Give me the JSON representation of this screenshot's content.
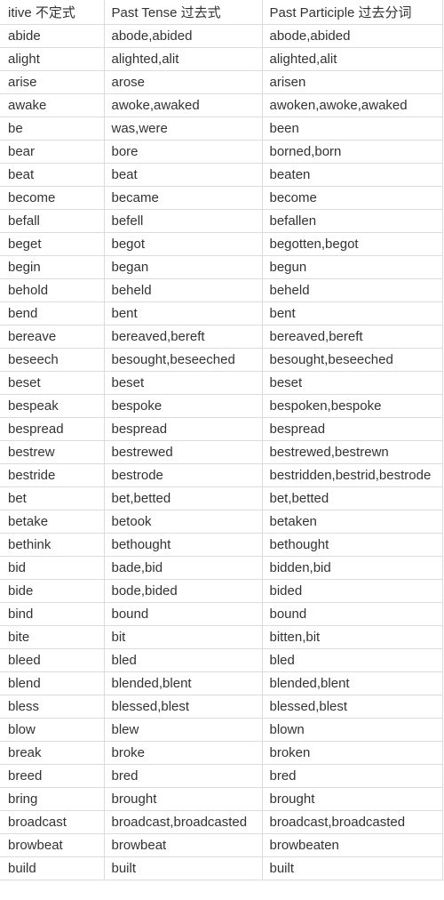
{
  "header": [
    "itive 不定式",
    "Past Tense 过去式",
    "Past Participle 过去分词"
  ],
  "rows": [
    [
      "abide",
      "abode,abided",
      "abode,abided"
    ],
    [
      "alight",
      "alighted,alit",
      "alighted,alit"
    ],
    [
      "arise",
      "arose",
      "arisen"
    ],
    [
      "awake",
      "awoke,awaked",
      "awoken,awoke,awaked"
    ],
    [
      "be",
      "was,were",
      "been"
    ],
    [
      "bear",
      "bore",
      "borned,born"
    ],
    [
      "beat",
      "beat",
      "beaten"
    ],
    [
      "become",
      "became",
      "become"
    ],
    [
      "befall",
      "befell",
      "befallen"
    ],
    [
      "beget",
      "begot",
      "begotten,begot"
    ],
    [
      "begin",
      "began",
      "begun"
    ],
    [
      "behold",
      "beheld",
      "beheld"
    ],
    [
      "bend",
      "bent",
      "bent"
    ],
    [
      "bereave",
      "bereaved,bereft",
      "bereaved,bereft"
    ],
    [
      "beseech",
      "besought,beseeched",
      "besought,beseeched"
    ],
    [
      "beset",
      "beset",
      "beset"
    ],
    [
      "bespeak",
      "bespoke",
      "bespoken,bespoke"
    ],
    [
      "bespread",
      "bespread",
      "bespread"
    ],
    [
      "bestrew",
      "bestrewed",
      "bestrewed,bestrewn"
    ],
    [
      "bestride",
      "bestrode",
      "bestridden,bestrid,bestrode"
    ],
    [
      "bet",
      "bet,betted",
      "bet,betted"
    ],
    [
      "betake",
      "betook",
      "betaken"
    ],
    [
      "bethink",
      "bethought",
      "bethought"
    ],
    [
      "bid",
      "bade,bid",
      "bidden,bid"
    ],
    [
      "bide",
      "bode,bided",
      "bided"
    ],
    [
      "bind",
      "bound",
      "bound"
    ],
    [
      "bite",
      "bit",
      "bitten,bit"
    ],
    [
      "bleed",
      "bled",
      "bled"
    ],
    [
      "blend",
      "blended,blent",
      "blended,blent"
    ],
    [
      "bless",
      "blessed,blest",
      "blessed,blest"
    ],
    [
      "blow",
      "blew",
      "blown"
    ],
    [
      "break",
      "broke",
      "broken"
    ],
    [
      "breed",
      "bred",
      "bred"
    ],
    [
      "bring",
      "brought",
      "brought"
    ],
    [
      "broadcast",
      "broadcast,broadcasted",
      "broadcast,broadcasted"
    ],
    [
      "browbeat",
      "browbeat",
      "browbeaten"
    ],
    [
      "build",
      "built",
      "built"
    ]
  ]
}
